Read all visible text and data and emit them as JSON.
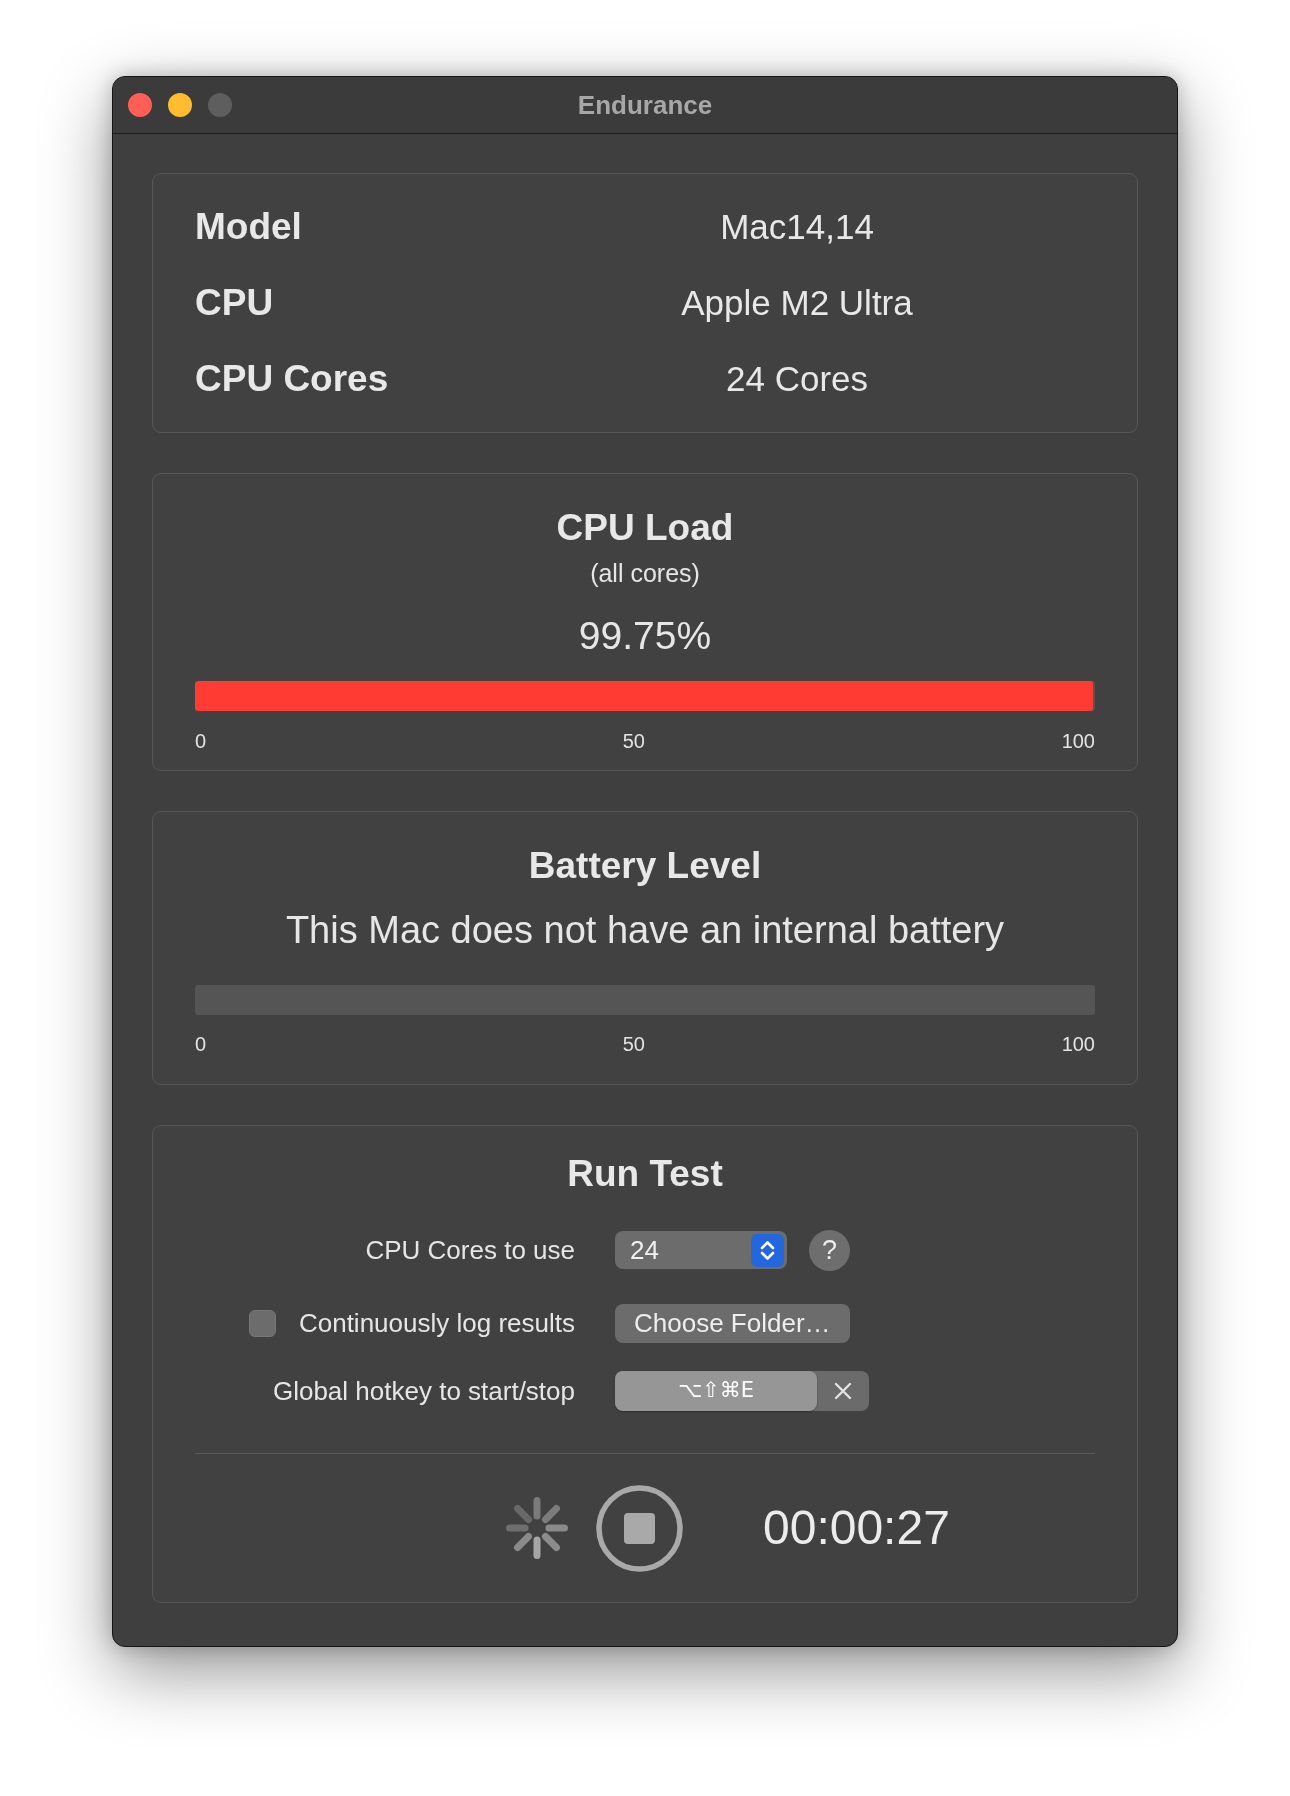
{
  "window": {
    "title": "Endurance",
    "buttons": [
      {
        "kind": "close",
        "disabled": false
      },
      {
        "kind": "minimize",
        "disabled": false
      },
      {
        "kind": "zoom",
        "disabled": true
      }
    ]
  },
  "info": [
    {
      "label": "Model",
      "value": "Mac14,14"
    },
    {
      "label": "CPU",
      "value": "Apple M2 Ultra"
    },
    {
      "label": "CPU Cores",
      "value": "24 Cores"
    }
  ],
  "cpu_load": {
    "title": "CPU Load",
    "subtitle": "(all cores)",
    "reading": "99.75%",
    "level": 0.9975,
    "scale": [
      "0",
      "50",
      "100"
    ]
  },
  "battery": {
    "title": "Battery Level",
    "message": "This Mac does not have an internal battery",
    "scale": [
      "0",
      "50",
      "100"
    ]
  },
  "run_test": {
    "title": "Run Test",
    "cores": {
      "label": "CPU Cores to use",
      "value": "24"
    },
    "help": "?",
    "log": {
      "checked": false,
      "label": "Continuously log results",
      "button": "Choose Folder…"
    },
    "hotkey": {
      "label": "Global hotkey to start/stop",
      "value": "⌥⇧⌘E"
    },
    "running": true,
    "elapsed": "00:00:27"
  }
}
